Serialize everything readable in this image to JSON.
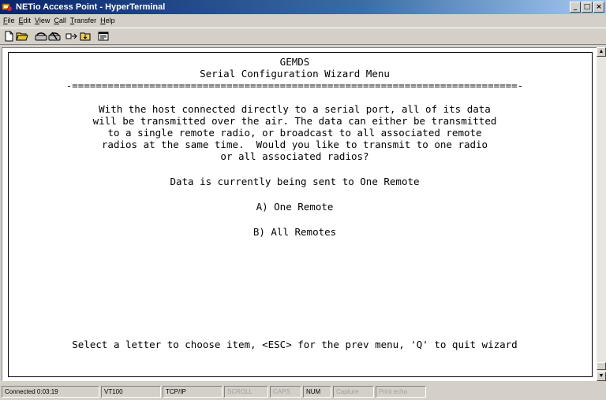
{
  "window": {
    "title": "NETio Access Point - HyperTerminal",
    "app_icon": "hyperterminal-icon",
    "buttons": [
      "minimize",
      "maximize",
      "close"
    ],
    "button_glyphs": {
      "minimize": "_",
      "maximize": "□",
      "close": "×"
    }
  },
  "menu": [
    {
      "label": "File",
      "u": "F",
      "rest": "ile"
    },
    {
      "label": "Edit",
      "u": "E",
      "rest": "dit"
    },
    {
      "label": "View",
      "u": "V",
      "rest": "iew"
    },
    {
      "label": "Call",
      "u": "C",
      "rest": "all"
    },
    {
      "label": "Transfer",
      "u": "T",
      "rest": "ransfer"
    },
    {
      "label": "Help",
      "u": "H",
      "rest": "elp"
    }
  ],
  "toolbar": {
    "icons": [
      "new-connection-icon",
      "open-icon",
      "call-icon",
      "disconnect-icon",
      "send-icon",
      "receive-icon",
      "properties-icon"
    ]
  },
  "terminal": {
    "header_line1": "GEMDS",
    "header_line2": "Serial Configuration Wizard Menu",
    "separator": "-===========================================================================-",
    "description": [
      "With the host connected directly to a serial port, all of its data",
      "will be transmitted over the air. The data can either be transmitted",
      "to a single remote radio, or broadcast to all associated remote",
      "radios at the same time.  Would you like to transmit to one radio",
      "or all associated radios?"
    ],
    "status_text": "Data is currently being sent to One Remote",
    "options": [
      {
        "key": "A",
        "text": "A) One Remote"
      },
      {
        "key": "B",
        "text": "B) All Remotes"
      }
    ],
    "footer": "Select a letter to choose item, <ESC> for the prev menu, 'Q' to quit wizard"
  },
  "statusbar": {
    "connected": "Connected 0:03:19",
    "emulation": "VT100",
    "protocol": "TCP/IP",
    "scroll": "SCROLL",
    "caps": "CAPS",
    "num": "NUM",
    "capture": "Capture",
    "print_echo": "Print echo"
  },
  "colors": {
    "title_gradient_start": "#0a246a",
    "title_gradient_end": "#a6caf0",
    "chrome": "#d4d0c8",
    "terminal_bg": "#ffffff"
  }
}
